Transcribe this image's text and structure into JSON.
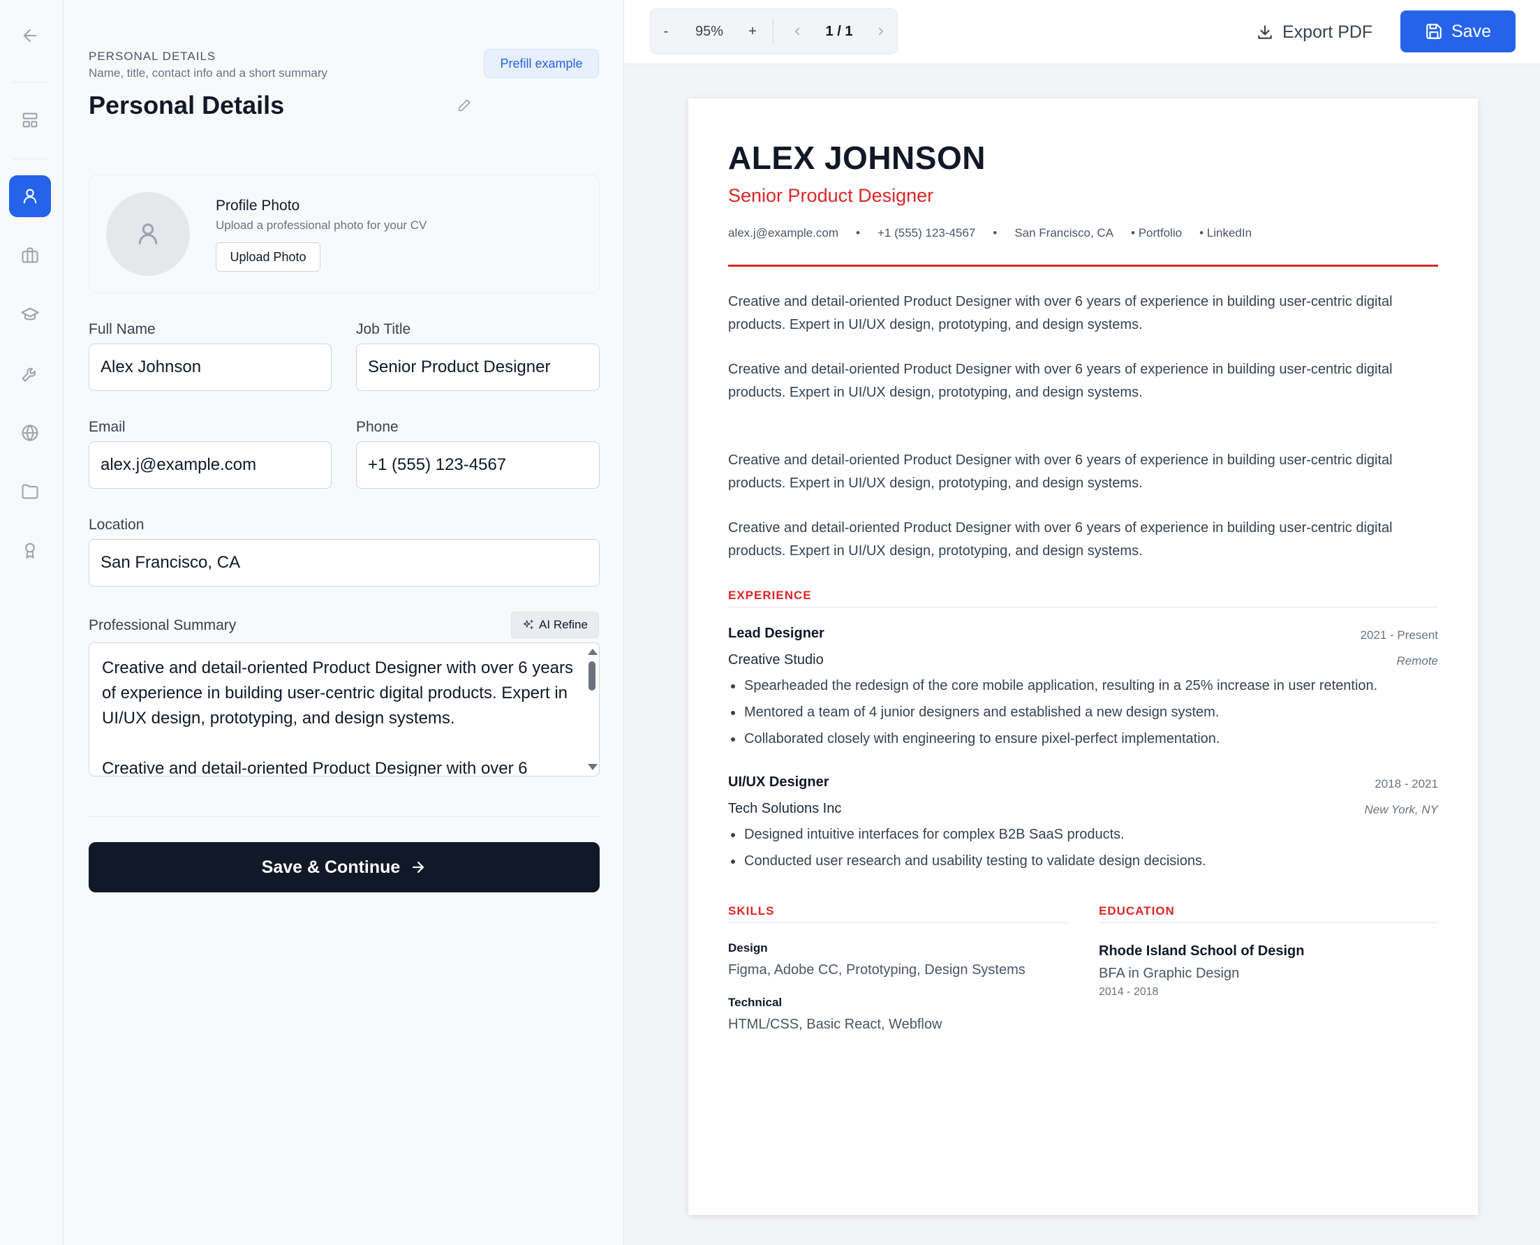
{
  "rail": {
    "back_icon": "arrow-left-icon",
    "items": [
      {
        "name": "layout-icon",
        "active": false
      },
      {
        "name": "user-icon",
        "active": true
      },
      {
        "name": "briefcase-icon",
        "active": false
      },
      {
        "name": "graduation-cap-icon",
        "active": false
      },
      {
        "name": "wrench-icon",
        "active": false
      },
      {
        "name": "globe-icon",
        "active": false
      },
      {
        "name": "folder-icon",
        "active": false
      },
      {
        "name": "award-icon",
        "active": false
      }
    ],
    "active_color": "#2563eb"
  },
  "form": {
    "eyebrow": "PERSONAL DETAILS",
    "eyebrow_sub": "Name, title, contact info and a short summary",
    "title": "Personal Details",
    "prefill_label": "Prefill example",
    "photo": {
      "title": "Profile Photo",
      "subtitle": "Upload a professional photo for your CV",
      "upload_label": "Upload Photo"
    },
    "fields": {
      "full_name": {
        "label": "Full Name",
        "value": "Alex Johnson"
      },
      "job_title": {
        "label": "Job Title",
        "value": "Senior Product Designer"
      },
      "email": {
        "label": "Email",
        "value": "alex.j@example.com"
      },
      "phone": {
        "label": "Phone",
        "value": "+1 (555) 123-4567"
      },
      "location": {
        "label": "Location",
        "value": "San Francisco, CA"
      }
    },
    "summary": {
      "label": "Professional Summary",
      "ai_refine_label": "AI Refine",
      "value": "Creative and detail-oriented Product Designer with over 6 years of experience in building user-centric digital products. Expert in UI/UX design, prototyping, and design systems.\n\nCreative and detail-oriented Product Designer with over 6"
    },
    "save_continue_label": "Save & Continue"
  },
  "toolbar": {
    "zoom_out": "-",
    "zoom_level": "95%",
    "zoom_in": "+",
    "page_indicator": "1 / 1",
    "export_label": "Export PDF",
    "save_label": "Save",
    "save_color": "#2563eb"
  },
  "resume": {
    "name": "ALEX JOHNSON",
    "title": "Senior Product Designer",
    "accent_color": "#dc2626",
    "contact": {
      "email": "alex.j@example.com",
      "phone": "+1 (555) 123-4567",
      "location": "San Francisco, CA",
      "portfolio": "• Portfolio",
      "linkedin": "• LinkedIn",
      "separator": "•"
    },
    "summary_paragraphs": [
      "Creative and detail-oriented Product Designer with over 6 years of experience in building user-centric digital products. Expert in UI/UX design, prototyping, and design systems.",
      "Creative and detail-oriented Product Designer with over 6 years of experience in building user-centric digital products. Expert in UI/UX design, prototyping, and design systems.",
      "Creative and detail-oriented Product Designer with over 6 years of experience in building user-centric digital products. Expert in UI/UX design, prototyping, and design systems.",
      "Creative and detail-oriented Product Designer with over 6 years of experience in building user-centric digital products. Expert in UI/UX design, prototyping, and design systems."
    ],
    "experience_heading": "EXPERIENCE",
    "experience": [
      {
        "role": "Lead Designer",
        "dates": "2021 - Present",
        "company": "Creative Studio",
        "location": "Remote",
        "bullets": [
          "Spearheaded the redesign of the core mobile application, resulting in a 25% increase in user retention.",
          "Mentored a team of 4 junior designers and established a new design system.",
          "Collaborated closely with engineering to ensure pixel-perfect implementation."
        ]
      },
      {
        "role": "UI/UX Designer",
        "dates": "2018 - 2021",
        "company": "Tech Solutions Inc",
        "location": "New York, NY",
        "bullets": [
          "Designed intuitive interfaces for complex B2B SaaS products.",
          "Conducted user research and usability testing to validate design decisions."
        ]
      }
    ],
    "skills_heading": "SKILLS",
    "skills": [
      {
        "category": "Design",
        "items": "Figma, Adobe CC, Prototyping, Design Systems"
      },
      {
        "category": "Technical",
        "items": "HTML/CSS, Basic React, Webflow"
      }
    ],
    "education_heading": "EDUCATION",
    "education": {
      "school": "Rhode Island School of Design",
      "degree": "BFA in Graphic Design",
      "years": "2014 - 2018"
    }
  }
}
